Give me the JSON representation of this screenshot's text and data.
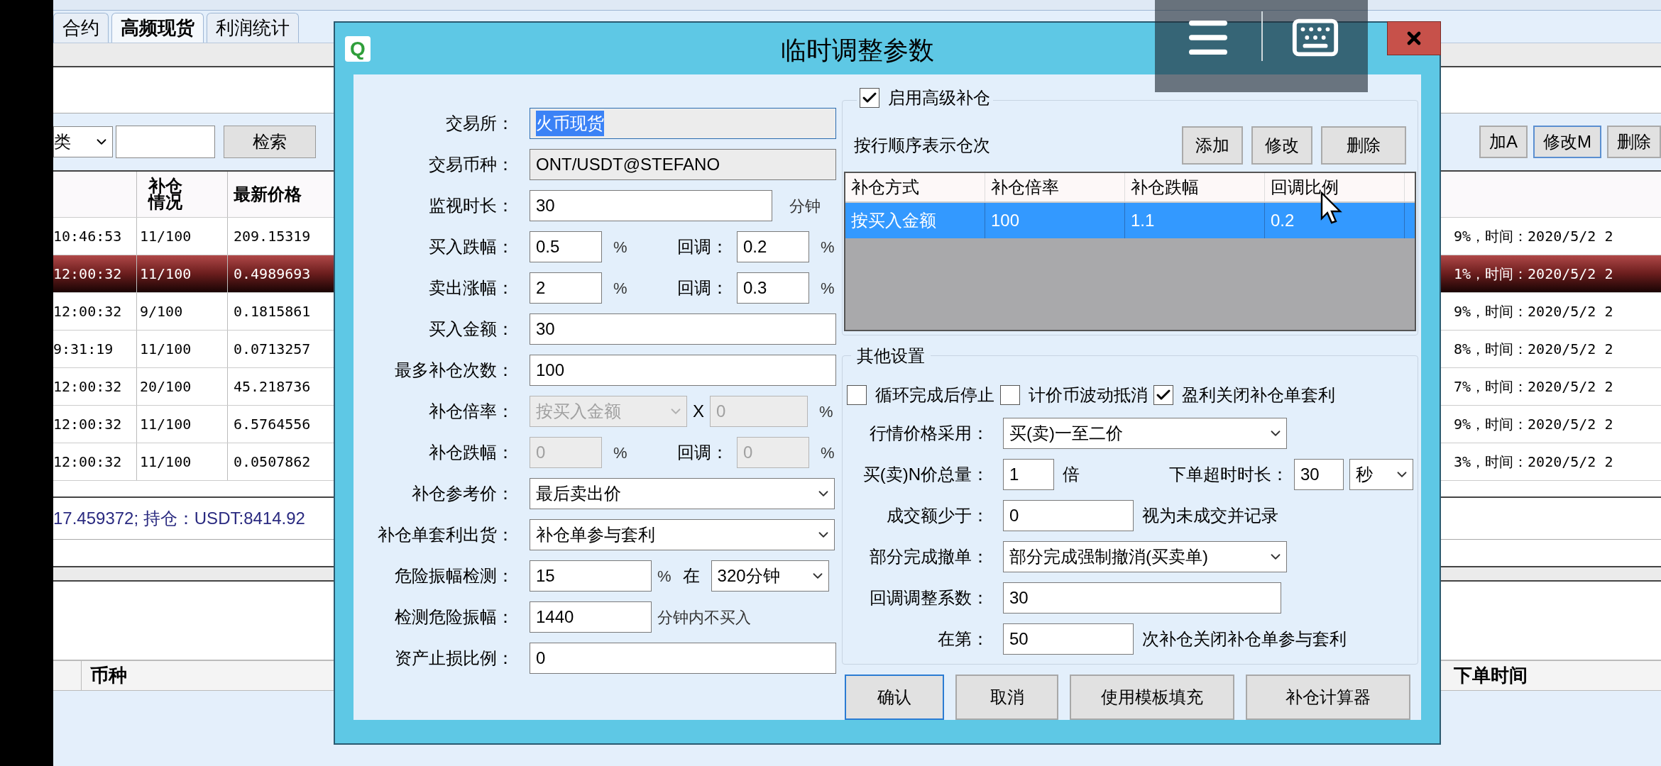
{
  "app": {
    "tabs": [
      {
        "label": "合约",
        "selected": false
      },
      {
        "label": "高频现货",
        "selected": true
      },
      {
        "label": "利润统计",
        "selected": false
      }
    ],
    "filter": {
      "category": "类",
      "search_button": "检索"
    },
    "actions": [
      {
        "label": "加A",
        "focused": false
      },
      {
        "label": "修改M",
        "focused": true
      },
      {
        "label": "删除",
        "focused": false
      }
    ],
    "table": {
      "columns": [
        "补仓情况",
        "最新价格"
      ],
      "rows": [
        {
          "time": "10:46:53",
          "position": "11/100",
          "price": "209.15319",
          "note": "9%，时间：2020/5/2 2",
          "selected": false
        },
        {
          "time": "12:00:32",
          "position": "11/100",
          "price": "0.4989693",
          "note": "1%，时间：2020/5/2 2",
          "selected": true
        },
        {
          "time": "12:00:32",
          "position": "9/100",
          "price": "0.1815861",
          "note": "9%，时间：2020/5/2 2",
          "selected": false
        },
        {
          "time": "9:31:19",
          "position": "11/100",
          "price": "0.0713257",
          "note": "8%，时间：2020/5/2 2",
          "selected": false
        },
        {
          "time": "12:00:32",
          "position": "20/100",
          "price": "45.218736",
          "note": "7%，时间：2020/5/2 2",
          "selected": false
        },
        {
          "time": "12:00:32",
          "position": "11/100",
          "price": "6.5764556",
          "note": "9%，时间：2020/5/2 2",
          "selected": false
        },
        {
          "time": "12:00:32",
          "position": "11/100",
          "price": "0.0507862",
          "note": "3%，时间：2020/5/2 2",
          "selected": false
        }
      ]
    },
    "status": "17.459372;  持仓：USDT:8414.92",
    "lower_table": {
      "columns": [
        "币种",
        "下单时间"
      ]
    }
  },
  "dialog": {
    "logo": "Q",
    "title": "临时调整参数",
    "left": [
      {
        "kind": "text",
        "label": "交易所：",
        "value": "火币现货",
        "readonly": true,
        "disabled": false,
        "text_selected": true
      },
      {
        "kind": "text",
        "label": "交易币种：",
        "value": "ONT/USDT@STEFANO",
        "readonly": true,
        "disabled": false,
        "text_selected": false
      },
      {
        "kind": "text_unit",
        "label": "监视时长：",
        "value": "30",
        "unit": "分钟",
        "readonly": false,
        "disabled": false,
        "text_selected": false
      },
      {
        "kind": "pair",
        "label": "买入跌幅：",
        "value": "0.5",
        "unit": "%",
        "label2": "回调：",
        "value2": "0.2",
        "unit2": "%",
        "readonly": false,
        "disabled": false,
        "text_selected": false
      },
      {
        "kind": "pair",
        "label": "卖出涨幅：",
        "value": "2",
        "unit": "%",
        "label2": "回调：",
        "value2": "0.3",
        "unit2": "%",
        "readonly": false,
        "disabled": false,
        "text_selected": false
      },
      {
        "kind": "text",
        "label": "买入金额：",
        "value": "30",
        "readonly": false,
        "disabled": false,
        "text_selected": false
      },
      {
        "kind": "text",
        "label": "最多补仓次数：",
        "value": "100",
        "readonly": false,
        "disabled": false,
        "text_selected": false
      },
      {
        "kind": "select_x",
        "label": "补仓倍率：",
        "value": "按买入金额",
        "mid": "X",
        "value2": "0",
        "unit2": "%",
        "readonly": false,
        "disabled": true,
        "text_selected": false
      },
      {
        "kind": "pair",
        "label": "补仓跌幅：",
        "value": "0",
        "unit": "%",
        "label2": "回调：",
        "value2": "0",
        "unit2": "%",
        "readonly": false,
        "disabled": true,
        "text_selected": false
      },
      {
        "kind": "select",
        "label": "补仓参考价：",
        "value": "最后卖出价",
        "readonly": false,
        "disabled": false,
        "text_selected": false
      },
      {
        "kind": "select",
        "label": "补仓单套利出货：",
        "value": "补仓单参与套利",
        "readonly": false,
        "disabled": false,
        "text_selected": false
      },
      {
        "kind": "amp",
        "label": "危险振幅检测：",
        "value": "15",
        "unit": "%",
        "mid": "在",
        "value2": "320分钟",
        "readonly": false,
        "disabled": false,
        "text_selected": false
      },
      {
        "kind": "short_unit",
        "label": "检测危险振幅：",
        "value": "1440",
        "unit": "分钟内不买入",
        "readonly": false,
        "disabled": false,
        "text_selected": false
      },
      {
        "kind": "text",
        "label": "资产止损比例：",
        "value": "0",
        "readonly": false,
        "disabled": false,
        "text_selected": false
      }
    ],
    "advanced": {
      "label": "启用高级补仓",
      "checked": true,
      "hint": "按行顺序表示仓次",
      "buttons": [
        "添加",
        "修改",
        "删除"
      ],
      "columns": [
        "补仓方式",
        "补仓倍率",
        "补仓跌幅",
        "回调比例"
      ],
      "rows": [
        {
          "cells": [
            "按买入金额",
            "100",
            "1.1",
            "0.2"
          ],
          "selected": true
        }
      ]
    },
    "other": {
      "title": "其他设置",
      "checks": [
        {
          "label": "循环完成后停止",
          "checked": false
        },
        {
          "label": "计价币波动抵消",
          "checked": false
        },
        {
          "label": "盈利关闭补仓单套利",
          "checked": true
        }
      ],
      "rows": [
        {
          "kind": "select",
          "label": "行情价格采用：",
          "value": "买(卖)一至二价"
        },
        {
          "kind": "volume",
          "label": "买(卖)N价总量：",
          "value": "1",
          "unit": "倍",
          "label2": "下单超时时长：",
          "value2": "30",
          "value3": "秒"
        },
        {
          "kind": "text_unit",
          "label": "成交额少于：",
          "value": "0",
          "unit": "视为未成交并记录"
        },
        {
          "kind": "select",
          "label": "部分完成撤单：",
          "value": "部分完成强制撤消(买卖单)"
        },
        {
          "kind": "text",
          "label": "回调调整系数：",
          "value": "30"
        },
        {
          "kind": "text_unit",
          "label": "在第：",
          "value": "50",
          "unit": "次补仓关闭补仓单参与套利"
        }
      ]
    },
    "buttons": [
      {
        "label": "确认",
        "focused": true
      },
      {
        "label": "取消",
        "focused": false
      },
      {
        "label": "使用模板填充",
        "focused": false
      },
      {
        "label": "补仓计算器",
        "focused": false
      }
    ]
  }
}
